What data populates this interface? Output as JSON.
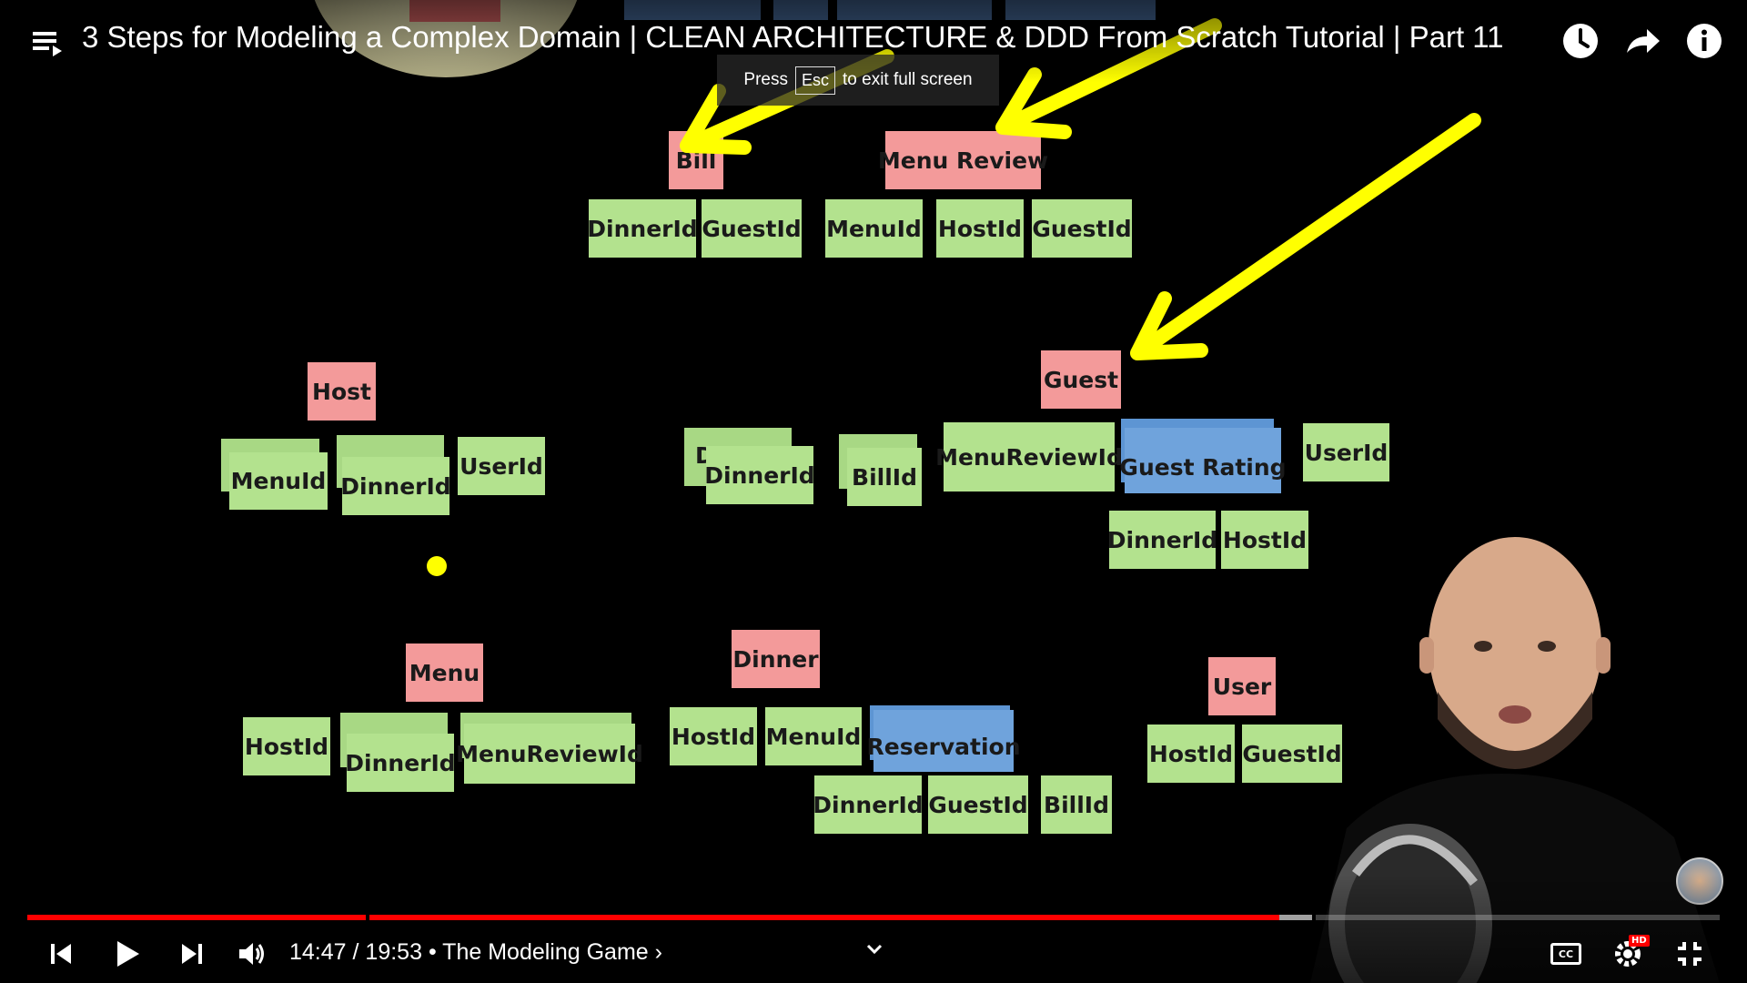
{
  "video": {
    "title": "3 Steps for Modeling a Complex Domain | CLEAN ARCHITECTURE & DDD From Scratch Tutorial | Part 11",
    "fullscreen_notice": {
      "press": "Press",
      "key": "Esc",
      "suffix": "to exit full screen"
    },
    "current_time": "14:47",
    "separator": "/",
    "duration": "19:53",
    "chapter": "• The Modeling Game ›",
    "progress_fraction": 0.74,
    "buffered_fraction": 0.76
  },
  "board": {
    "aggregates": [
      {
        "label": "Bill"
      },
      {
        "label": "Menu Review"
      },
      {
        "label": "Host"
      },
      {
        "label": "Guest"
      },
      {
        "label": "Menu"
      },
      {
        "label": "Dinner"
      },
      {
        "label": "User"
      }
    ],
    "bill_refs": [
      "DinnerId",
      "GuestId"
    ],
    "menu_review_refs": [
      "MenuId",
      "HostId",
      "GuestId"
    ],
    "host_refs": [
      "MenuId",
      "DinnerId",
      "UserId"
    ],
    "middle_refs": [
      "DinnerId",
      "BillId"
    ],
    "guest_refs": [
      "MenuReviewId",
      "Guest Rating",
      "UserId",
      "DinnerId",
      "HostId"
    ],
    "menu_refs": [
      "HostId",
      "DinnerId",
      "MenuReviewId"
    ],
    "dinner_refs": [
      "HostId",
      "MenuId",
      "Reservation",
      "DinnerId",
      "GuestId",
      "BillId"
    ],
    "user_refs": [
      "HostId",
      "GuestId"
    ]
  },
  "colors": {
    "aggregate": "#f39a9a",
    "reference": "#b3e28e",
    "entity": "#6fa3dc",
    "arrow": "#ffff00",
    "progress": "#ff0000"
  },
  "icons": [
    "playlist-icon",
    "watch-later-icon",
    "share-icon",
    "info-icon",
    "previous-icon",
    "play-icon",
    "next-icon",
    "volume-icon",
    "chevron-down-icon",
    "captions-icon",
    "settings-icon",
    "exit-fullscreen-icon"
  ],
  "badges": {
    "hd": "HD",
    "cc": "CC"
  }
}
